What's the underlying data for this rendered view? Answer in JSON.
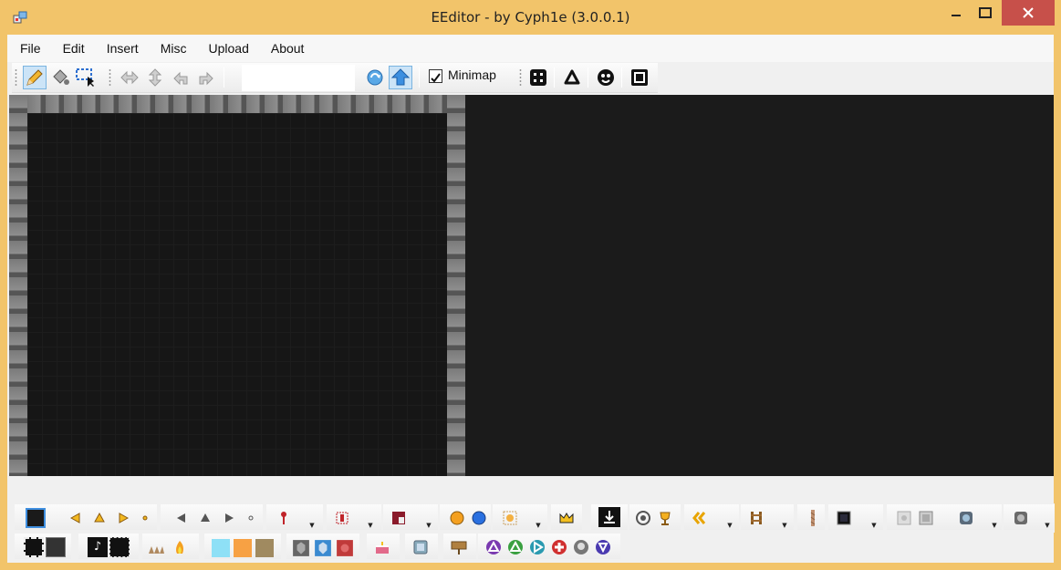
{
  "window": {
    "title": "EEditor - by Cyph1e (3.0.0.1)"
  },
  "menu": [
    "File",
    "Edit",
    "Insert",
    "Misc",
    "Upload",
    "About"
  ],
  "toolbar": {
    "tools": [
      "pencil-icon",
      "fill-bucket-icon",
      "select-icon"
    ],
    "transforms": [
      "flip-horizontal-icon",
      "flip-vertical-icon",
      "rotate-left-icon",
      "rotate-right-icon"
    ],
    "minimap": {
      "label": "Minimap",
      "checked": true
    },
    "extras": [
      "grid-icon",
      "triangle-icon",
      "emoji-icon",
      "frame-icon"
    ]
  },
  "colors": {
    "accent": "#f2c46a",
    "close": "#c7504a",
    "editor_bg": "#1b1b1b"
  }
}
